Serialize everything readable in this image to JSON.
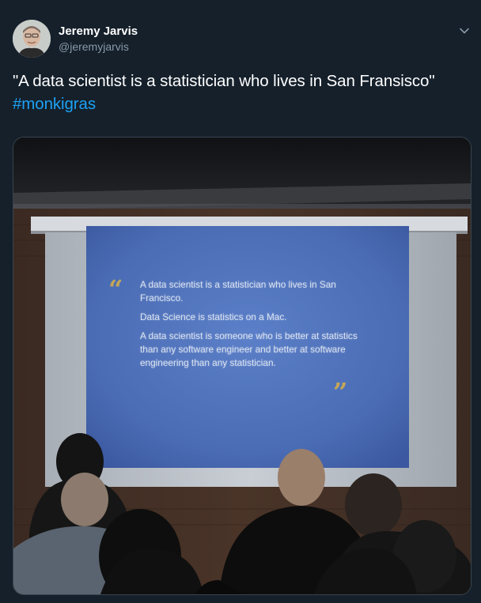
{
  "author": {
    "display_name": "Jeremy Jarvis",
    "handle": "@jeremyjarvis"
  },
  "tweet": {
    "text": "\"A data scientist is a statistician who lives in San Fransisco\" ",
    "hashtag": "#monkigras"
  },
  "media": {
    "slide_lines": [
      "A data scientist is a statistician who lives in San Francisco.",
      "Data Science is statistics on a Mac.",
      "A data scientist is someone who is better at statistics than any software engineer and better at software engineering than any statistician."
    ],
    "quote_open": "“",
    "quote_close": "”"
  },
  "colors": {
    "background": "#15202b",
    "text": "#ffffff",
    "secondary": "#8899a6",
    "link": "#1da1f2",
    "border": "#38444d"
  },
  "icons": {
    "menu": "chevron-down-icon"
  }
}
